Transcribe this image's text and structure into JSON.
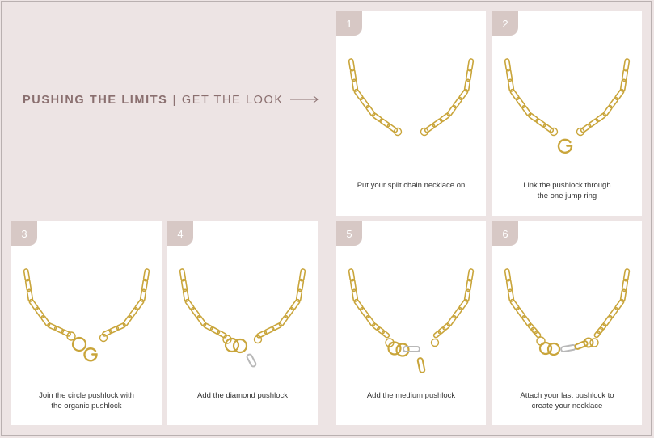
{
  "header": {
    "title_bold": "PUSHING THE LIMITS",
    "separator": "|",
    "title_light": "GET THE LOOK",
    "arrow_icon": "long-right-arrow-icon"
  },
  "colors": {
    "background": "#ede4e4",
    "card": "#ffffff",
    "badge": "#d7c8c5",
    "title": "#8a6f6f",
    "gold": "#c9a53b",
    "silver": "#b8b8b8"
  },
  "steps": [
    {
      "number": "1",
      "caption_lines": [
        "Put your split chain necklace on"
      ]
    },
    {
      "number": "2",
      "caption_lines": [
        "Link the pushlock through",
        "the one jump ring"
      ]
    },
    {
      "number": "3",
      "caption_lines": [
        "Join the circle pushlock with",
        "the organic pushlock"
      ]
    },
    {
      "number": "4",
      "caption_lines": [
        "Add the diamond pushlock"
      ]
    },
    {
      "number": "5",
      "caption_lines": [
        "Add the medium pushlock"
      ]
    },
    {
      "number": "6",
      "caption_lines": [
        "Attach your last pushlock to",
        "create your necklace"
      ]
    }
  ]
}
